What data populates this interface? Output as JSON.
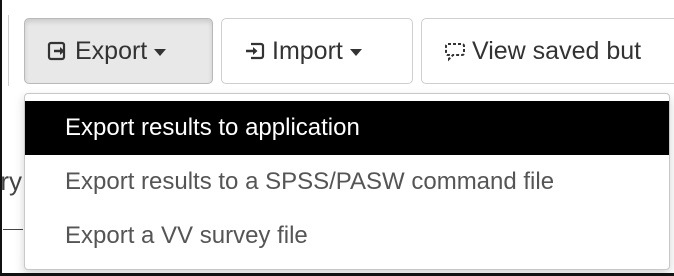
{
  "toolbar": {
    "export_label": "Export",
    "import_label": "Import",
    "view_saved_label": "View saved but"
  },
  "background": {
    "partial_text": "ry"
  },
  "export_menu": {
    "items": [
      {
        "label": "Export results to application",
        "highlighted": true
      },
      {
        "label": "Export results to a SPSS/PASW command file",
        "highlighted": false
      },
      {
        "label": "Export a VV survey file",
        "highlighted": false
      }
    ]
  },
  "icons": {
    "export": "export-icon",
    "import": "import-icon",
    "view_saved": "comment-icon",
    "caret": "caret-down-icon"
  }
}
